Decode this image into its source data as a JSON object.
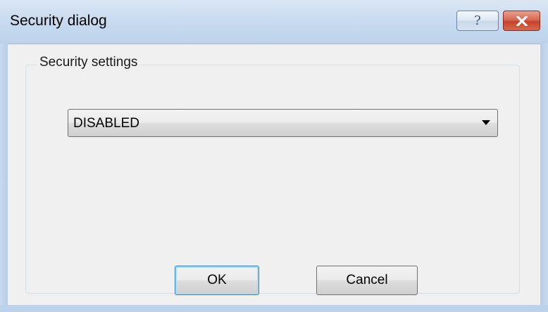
{
  "window": {
    "title": "Security dialog",
    "help_button": "?",
    "close_button_icon": "close-icon"
  },
  "group": {
    "label": "Security settings"
  },
  "security_select": {
    "selected_value": "DISABLED"
  },
  "buttons": {
    "ok_label": "OK",
    "cancel_label": "Cancel"
  },
  "colors": {
    "titlebar": "#c9dbef",
    "client_background": "#f0f0f0",
    "close_button": "#c5432a",
    "default_button_focus": "#3c7fb1"
  }
}
